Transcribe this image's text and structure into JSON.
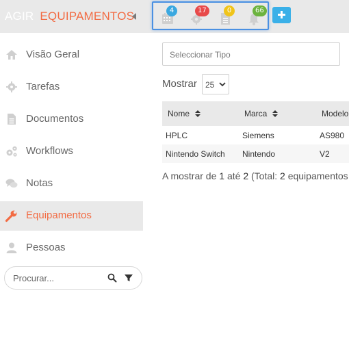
{
  "header": {
    "app_name": "AGIR",
    "section_title": "EQUIPAMENTOS",
    "notifications": [
      {
        "icon": "calendar-icon",
        "count": "4",
        "color": "#3aa8e0"
      },
      {
        "icon": "gear-icon",
        "count": "17",
        "color": "#e84a4a"
      },
      {
        "icon": "document-icon",
        "count": "0",
        "color": "#f0c419"
      },
      {
        "icon": "bell-icon",
        "count": "66",
        "color": "#6cb33e"
      }
    ],
    "add_button": "+"
  },
  "sidebar": {
    "items": [
      {
        "label": "Visão Geral",
        "icon": "home-icon",
        "active": false
      },
      {
        "label": "Tarefas",
        "icon": "gear-icon",
        "active": false
      },
      {
        "label": "Documentos",
        "icon": "document-icon",
        "active": false
      },
      {
        "label": "Workflows",
        "icon": "gears-icon",
        "active": false
      },
      {
        "label": "Notas",
        "icon": "chat-icon",
        "active": false
      },
      {
        "label": "Equipamentos",
        "icon": "wrench-icon",
        "active": true
      },
      {
        "label": "Pessoas",
        "icon": "user-icon",
        "active": false
      }
    ],
    "search": {
      "placeholder": "Procurar..."
    }
  },
  "main": {
    "type_select_placeholder": "Seleccionar Tipo",
    "show_label": "Mostrar",
    "page_size": "25",
    "table": {
      "columns": [
        "Nome",
        "Marca",
        "Modelo"
      ],
      "rows": [
        [
          "HPLC",
          "Siemens",
          "AS980"
        ],
        [
          "Nintendo Switch",
          "Nintendo",
          "V2"
        ]
      ]
    },
    "summary": {
      "prefix": "A mostrar de",
      "from": "1",
      "to_word": "até",
      "to": "2",
      "total_prefix": "(Total:",
      "total": "2",
      "suffix": "equipamentos"
    }
  },
  "colors": {
    "accent": "#f26b43",
    "highlight_border": "#4a90e2",
    "add_button": "#3ab0e8",
    "icon_gray": "#cfcfcf"
  }
}
